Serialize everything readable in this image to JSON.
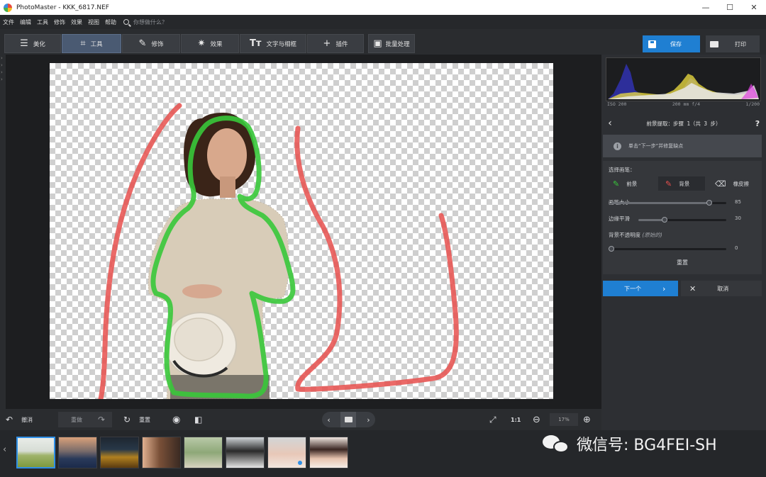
{
  "window": {
    "title": "PhotoMaster - KKK_6817.NEF",
    "minimize_glyph": "—",
    "maximize_glyph": "☐",
    "close_glyph": "✕"
  },
  "menubar": {
    "items": [
      "文件",
      "编辑",
      "工具",
      "修饰",
      "效果",
      "视图",
      "帮助"
    ],
    "search_placeholder": "你想做什么？"
  },
  "toolbar": {
    "tabs": [
      {
        "label": "美化",
        "icon": "sliders-icon"
      },
      {
        "label": "工具",
        "icon": "crop-icon"
      },
      {
        "label": "修饰",
        "icon": "brush-icon"
      },
      {
        "label": "效果",
        "icon": "sparkle-icon"
      },
      {
        "label": "文字与相框",
        "icon": "text-icon"
      },
      {
        "label": "插件",
        "icon": "plus-icon"
      }
    ],
    "active_tab": "工具",
    "batch_label": "批量处理",
    "save_label": "保存",
    "print_label": "打印"
  },
  "histogram": {
    "iso": "ISO 200",
    "lens": "200 mm f/4",
    "shutter": "1/200"
  },
  "panel": {
    "step_title": "前景提取：步骤 1（共 3 步）",
    "help": "?",
    "hint": "单击“下一步”并修复缺点",
    "select_brush_label": "选择画笔：",
    "brushes": [
      {
        "label": "前景",
        "active": false
      },
      {
        "label": "背景",
        "active": true
      },
      {
        "label": "橡皮擦",
        "active": false
      }
    ],
    "sliders": [
      {
        "label": "画笔大小",
        "value": "85",
        "fraction": 0.85
      },
      {
        "label": "边缘平滑",
        "value": "30",
        "fraction": 0.3
      },
      {
        "label": "背景不透明度",
        "label_note": "(原始的)",
        "value": "0",
        "fraction": 0.0
      }
    ],
    "reset_label": "重置",
    "next_label": "下一个",
    "cancel_label": "取消"
  },
  "bottombar": {
    "undo_label": "撤消",
    "redo_label": "重做",
    "reset_label": "重置",
    "zoom_one": "1:1",
    "zoom_value": "17%"
  },
  "filmstrip": {
    "count": 8,
    "selected_index": 0
  },
  "watermark": {
    "text": "微信号: BG4FEI-SH"
  },
  "colors": {
    "accent": "#1f7fd2",
    "foreground_stroke": "#38c83a",
    "background_stroke": "#e8504e"
  }
}
